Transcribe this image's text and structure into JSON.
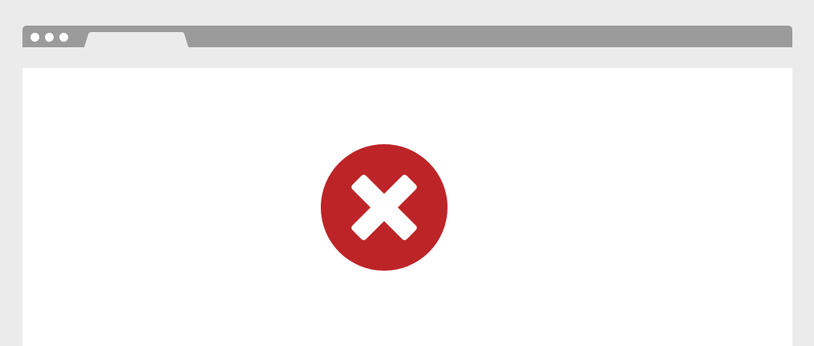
{
  "colors": {
    "page_background": "#ebebeb",
    "title_bar": "#9b9b9b",
    "window_dots": "#ffffff",
    "tab": "#ebebeb",
    "toolbar": "#ebebeb",
    "viewport": "#ffffff",
    "error_circle": "#bd2427",
    "error_cross": "#ffffff"
  },
  "browser": {
    "window_controls": [
      "dot",
      "dot",
      "dot"
    ],
    "tab": {
      "label": ""
    }
  },
  "content": {
    "icon": "error-x-icon"
  }
}
